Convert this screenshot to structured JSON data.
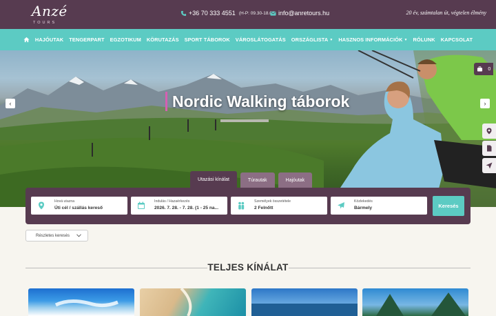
{
  "header": {
    "logo_text": "Anzé",
    "logo_sub": "TOURS",
    "phone": "+36 70 333 4551",
    "phone_hours": "(H-P: 09.30-18.00)",
    "email": "info@anretours.hu",
    "tagline": "20 év, számtalan út, végtelen élmény"
  },
  "nav": {
    "items": [
      {
        "label": "HAJÓUTAK"
      },
      {
        "label": "TENGERPART"
      },
      {
        "label": "EGZOTIKUM"
      },
      {
        "label": "KÖRUTAZÁS"
      },
      {
        "label": "SPORT TÁBOROK"
      },
      {
        "label": "VÁROSLÁTOGATÁS"
      },
      {
        "label": "ORSZÁGLISTA"
      },
      {
        "label": "HASZNOS INFORMÁCIÓK"
      },
      {
        "label": "RÓLUNK"
      },
      {
        "label": "KAPCSOLAT"
      }
    ]
  },
  "hero": {
    "title": "Nordic Walking táborok",
    "prev_icon": "‹",
    "next_icon": "›",
    "cart_count": "0"
  },
  "tabs": [
    {
      "label": "Utazási kínálat"
    },
    {
      "label": "Túrautak"
    },
    {
      "label": "Hajóutak"
    }
  ],
  "search": {
    "destination_label": "Hová utazna",
    "destination_value": "Úti cél / szállás kereső",
    "dates_label": "Indulás / Hazaérkezés",
    "dates_value": "2026. 7. 28. - 7. 28. (1 - 25 na...",
    "persons_label": "Személyek összetétele",
    "persons_value": "2 Felnőtt",
    "transport_label": "Közlekedés",
    "transport_value": "Bármely",
    "button": "Keresés"
  },
  "detailed_search": "Részletes keresés",
  "section_title": "TELJES KÍNÁLAT",
  "colors": {
    "brand_purple": "#573b50",
    "accent_teal": "#5ccbc3",
    "title_accent": "#d65fb2"
  }
}
